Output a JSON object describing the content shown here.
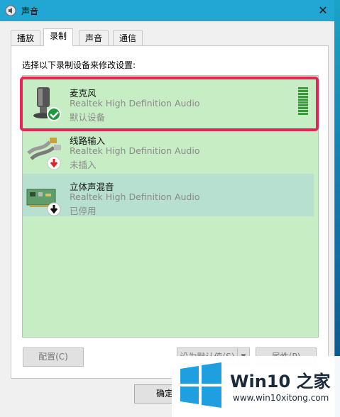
{
  "window": {
    "title": "声音",
    "close_glyph": "✕"
  },
  "tabs": [
    {
      "label": "播放"
    },
    {
      "label": "录制"
    },
    {
      "label": "声音"
    },
    {
      "label": "通信"
    }
  ],
  "instruction": "选择以下录制设备来修改设置:",
  "devices": [
    {
      "name": "麦克风",
      "driver": "Realtek High Definition Audio",
      "status": "默认设备",
      "icon": "microphone-icon",
      "badge": "green-check"
    },
    {
      "name": "线路输入",
      "driver": "Realtek High Definition Audio",
      "status": "未插入",
      "icon": "line-in-cable-icon",
      "badge": "red-down-arrow"
    },
    {
      "name": "立体声混音",
      "driver": "Realtek High Definition Audio",
      "status": "已停用",
      "icon": "sound-card-icon",
      "badge": "black-down-arrow"
    }
  ],
  "level_meter_bars": 10,
  "buttons": {
    "configure": "配置(C)",
    "set_default": "设为默认值(S)",
    "properties": "属性(P)",
    "ok": "确定"
  },
  "watermark": {
    "title": "Win10 之家",
    "url": "www.win10xitong.com"
  },
  "colors": {
    "titlebar": "#22a6d4",
    "list_background": "#c7edc5",
    "highlight_border": "#e8235a",
    "level_meter": "#2fa22f"
  }
}
